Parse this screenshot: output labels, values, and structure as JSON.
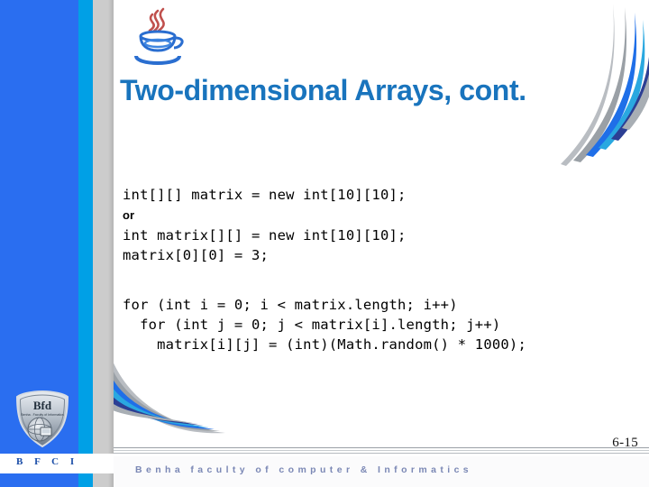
{
  "slide": {
    "title": "Two-dimensional Arrays, cont.",
    "page_number": "6-15",
    "title_color": "#1974bd",
    "band_colors": {
      "blue": "#2a6ef0",
      "cyan": "#00a0e6",
      "gray": "#cccccc"
    }
  },
  "logo": {
    "java_icon": "java-coffee-cup-icon",
    "emblem_icon": "bfci-shield-globe-icon",
    "emblem_label": "B F C I"
  },
  "code": {
    "block1_line1": "int[][] matrix = new int[10][10];",
    "block1_or": "or",
    "block1_line2": "int matrix[][] = new int[10][10];",
    "block1_line3": "matrix[0][0] = 3;",
    "block2_line1": "for (int i = 0; i < matrix.length; i++)",
    "block2_line2": "  for (int j = 0; j < matrix[i].length; j++)",
    "block2_line3": "    matrix[i][j] = (int)(Math.random() * 1000);"
  },
  "footer": {
    "text": "Benha faculty of computer & Informatics"
  }
}
